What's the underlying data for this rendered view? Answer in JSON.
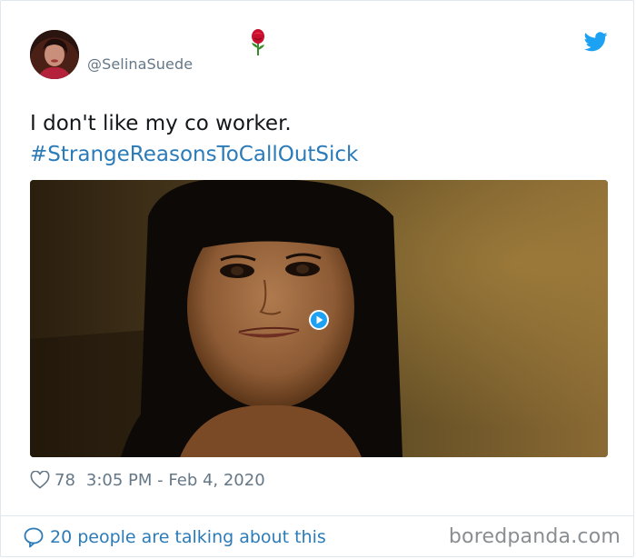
{
  "tweet": {
    "handle": "@SelinaSuede",
    "text_line": "I don't like my co worker.",
    "hashtag": "#StrangeReasonsToCallOutSick",
    "likes": "78",
    "timestamp": "3:05 PM - Feb 4, 2020"
  },
  "footer": {
    "conversation": "20 people are talking about this",
    "watermark": "boredpanda.com"
  },
  "icons": {
    "header_emoji": "rose-icon",
    "brand": "twitter-bird-icon",
    "like": "heart-outline-icon",
    "reply": "speech-bubble-icon",
    "media_overlay": "play-icon"
  },
  "colors": {
    "link": "#2b7bb9",
    "twitter_blue": "#1da1f2",
    "muted_text": "#657786",
    "body_text": "#14171a",
    "border": "#e1e8ed"
  }
}
